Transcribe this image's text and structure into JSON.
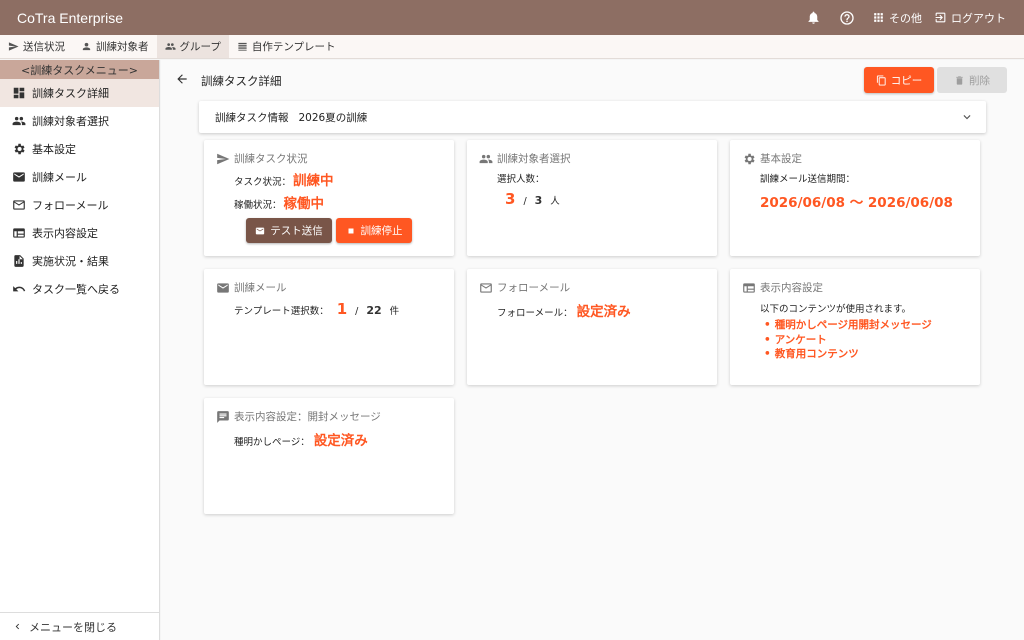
{
  "app": {
    "brand": "CoTra Enterprise",
    "other_label": "その他",
    "logout_label": "ログアウト"
  },
  "subnav": [
    {
      "label": "送信状況"
    },
    {
      "label": "訓練対象者"
    },
    {
      "label": "グループ"
    },
    {
      "label": "自作テンプレート"
    }
  ],
  "sidebar": {
    "header": "<訓練タスクメニュー>",
    "items": [
      {
        "label": "訓練タスク詳細",
        "icon": "dashboard-icon"
      },
      {
        "label": "訓練対象者選択",
        "icon": "people-icon"
      },
      {
        "label": "基本設定",
        "icon": "gear-icon"
      },
      {
        "label": "訓練メール",
        "icon": "mail-filled-icon"
      },
      {
        "label": "フォローメール",
        "icon": "mail-outline-icon"
      },
      {
        "label": "表示内容設定",
        "icon": "web-icon"
      },
      {
        "label": "実施状況・結果",
        "icon": "report-icon"
      },
      {
        "label": "タスク一覧へ戻る",
        "icon": "undo-icon"
      }
    ],
    "close_label": "メニューを閉じる"
  },
  "main": {
    "title": "訓練タスク詳細",
    "copy_label": "コピー",
    "delete_label": "削除",
    "expander": {
      "label": "訓練タスク情報",
      "value": "2026夏の訓練"
    }
  },
  "cards": {
    "status": {
      "title": "訓練タスク状況",
      "task_status_label": "タスク状況：",
      "task_status_value": "訓練中",
      "run_status_label": "稼働状況：",
      "run_status_value": "稼働中",
      "test_button": "テスト送信",
      "stop_button": "訓練停止"
    },
    "targets": {
      "title": "訓練対象者選択",
      "count_label": "選択人数：",
      "selected": "3",
      "sep": "/",
      "total": "3",
      "unit": "人"
    },
    "basic": {
      "title": "基本設定",
      "period_label": "訓練メール送信期間：",
      "period_value": "2026/06/08 ～ 2026/06/08"
    },
    "training_mail": {
      "title": "訓練メール",
      "template_label": "テンプレート選択数：",
      "selected": "1",
      "sep": "/",
      "total": "22",
      "unit": "件"
    },
    "follow_mail": {
      "title": "フォローメール",
      "label": "フォローメール：",
      "value": "設定済み"
    },
    "display": {
      "title": "表示内容設定",
      "intro": "以下のコンテンツが使用されます。",
      "items": [
        "種明かしページ用開封メッセージ",
        "アンケート",
        "教育用コンテンツ"
      ]
    },
    "open_message": {
      "title": "表示内容設定：開封メッセージ",
      "label": "種明かしページ：",
      "value": "設定済み"
    }
  },
  "colors": {
    "appbar": "#8d6e63",
    "accent": "#ff5722",
    "brown_button": "#795548"
  }
}
